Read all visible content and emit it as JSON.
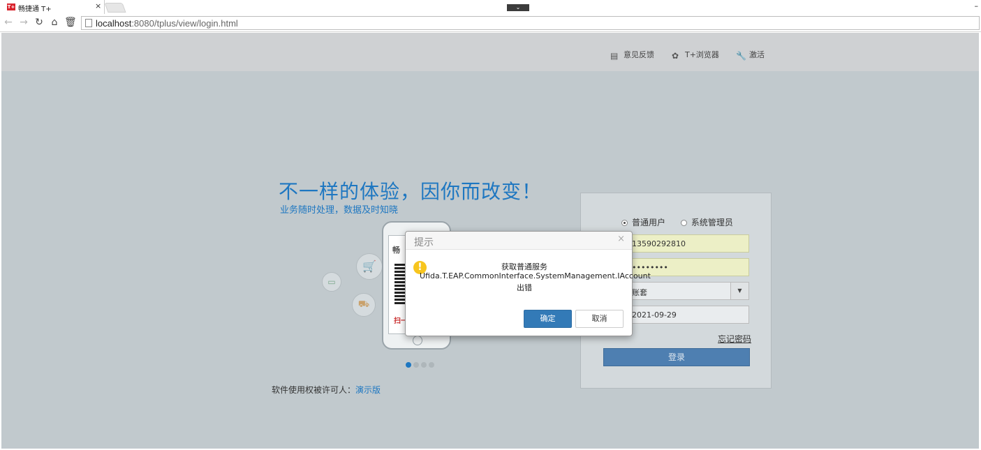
{
  "browser": {
    "tab_icon_text": "T+",
    "tab_title": "畅捷通 T+",
    "tab_close": "×",
    "url_host": "localhost",
    "url_rest": ":8080/tplus/view/login.html",
    "minimize": "–"
  },
  "header": {
    "feedback": "意见反馈",
    "browser": "T+浏览器",
    "activate": "激活"
  },
  "hero": {
    "slogan": "不一样的体验，因你而改变！",
    "sub_slogan": "业务随时处理，数据及时知晓",
    "phone_brand": "畅",
    "phone_red_text": "扫一"
  },
  "license": {
    "label": "软件使用权被许可人：",
    "link": "演示版"
  },
  "login": {
    "role_normal": "普通用户",
    "role_admin": "系统管理员",
    "username": "13590292810",
    "password": "••••••••",
    "account_set": "账套",
    "date": "2021-09-29",
    "forgot": "忘记密码",
    "submit": "登录"
  },
  "dialog": {
    "title": "提示",
    "close": "×",
    "message_line1": "获取普通服务",
    "message_line2": "Ufida.T.EAP.CommonInterface.SystemManagement.IAccount",
    "message_line3": "出错",
    "ok": "确定",
    "cancel": "取消"
  },
  "colors": {
    "accent_blue": "#1e77c1",
    "dialog_primary": "#337ab7",
    "login_button": "#4e7fb1",
    "warning": "#f7c51e"
  }
}
